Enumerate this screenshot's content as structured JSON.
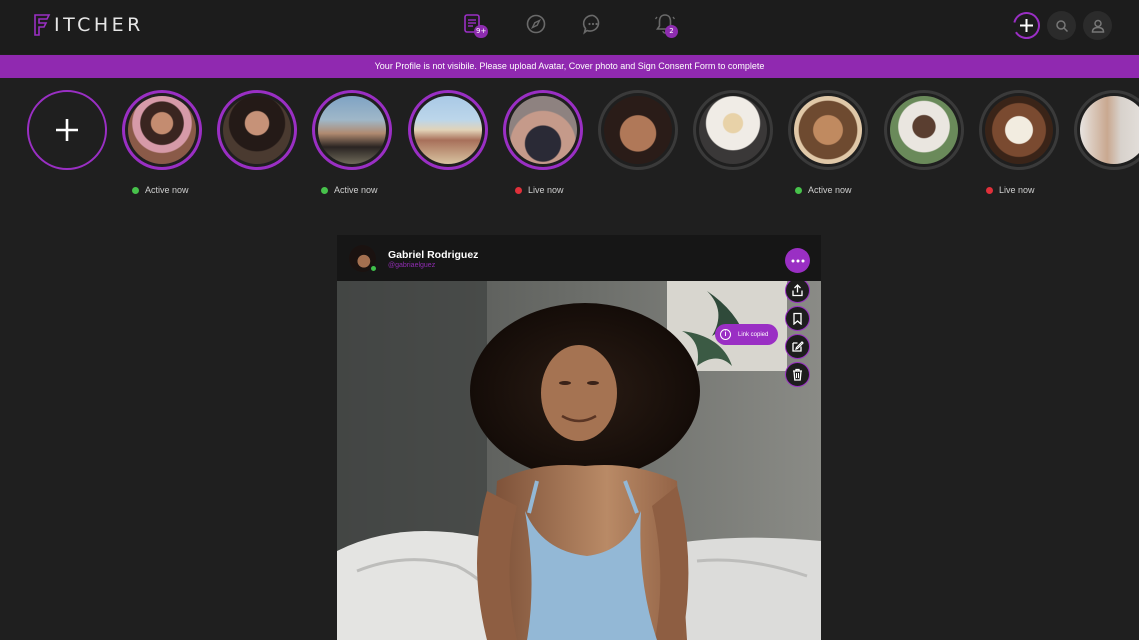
{
  "app": {
    "logo_text": "ITCHER",
    "logo_initial": "F"
  },
  "nav": {
    "feed_badge": "9+",
    "notifications_badge": "2",
    "icons": [
      "feed-icon",
      "explore-icon",
      "messages-icon",
      "bell-icon"
    ]
  },
  "banner": {
    "text": "Your Profile is not visibile. Please upload Avatar, Cover photo and Sign Consent Form to complete"
  },
  "stories": {
    "items": [
      {
        "status": "Active now",
        "status_color": "#47c24b",
        "ring": "active"
      },
      {
        "status": "",
        "ring": "active"
      },
      {
        "status": "Active now",
        "status_color": "#47c24b",
        "ring": "active"
      },
      {
        "status": "",
        "ring": "active"
      },
      {
        "status": "Live now",
        "status_color": "#e0303a",
        "ring": "active"
      },
      {
        "status": "",
        "ring": "seen"
      },
      {
        "status": "",
        "ring": "seen"
      },
      {
        "status": "Active now",
        "status_color": "#47c24b",
        "ring": "seen"
      },
      {
        "status": "",
        "ring": "seen"
      },
      {
        "status": "Live now",
        "status_color": "#e0303a",
        "ring": "seen"
      },
      {
        "status": "",
        "ring": "seen"
      }
    ]
  },
  "post": {
    "author_name": "Gabriel Rodriguez",
    "author_handle": "@gabriaelguez",
    "tooltip": "Link copied",
    "tooltip_icon": "i",
    "actions": [
      "share-icon",
      "bookmark-icon",
      "edit-icon",
      "trash-icon"
    ]
  },
  "colors": {
    "accent": "#9a2fc4",
    "banner": "#9029b0",
    "background": "#1f1f1f",
    "active": "#47c24b",
    "live": "#e0303a"
  }
}
